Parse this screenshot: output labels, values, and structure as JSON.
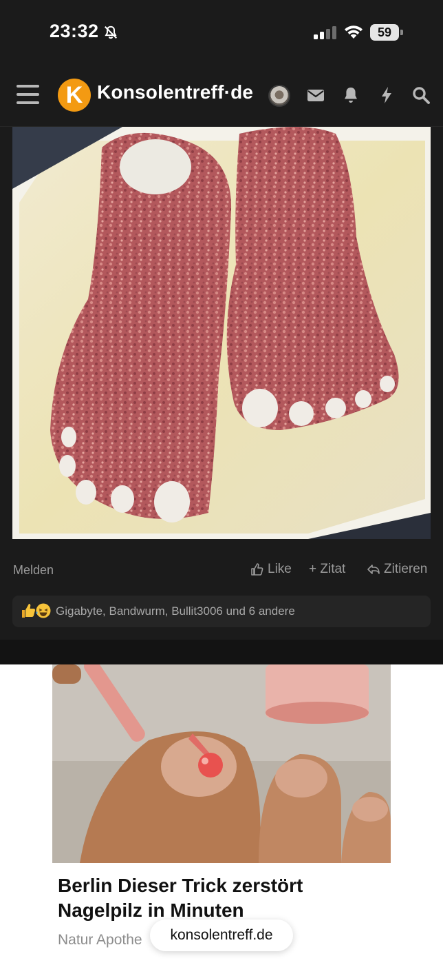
{
  "status_bar": {
    "time": "23:32",
    "battery": "59"
  },
  "header": {
    "site_name": "Konsolentreff·de",
    "logo_letter": "K"
  },
  "post": {
    "report_label": "Melden",
    "actions": {
      "like_label": "Like",
      "quote_label": "+ Zitat",
      "reply_label": "Zitieren"
    },
    "reactions_text": "Gigabyte, Bandwurm, Bullit3006 und 6 andere",
    "reaction_icons": [
      "thumbs-up-emoji",
      "laughing-emoji"
    ]
  },
  "ad": {
    "headline": "Berlin Dieser Trick zerstört Nagelpilz in Minuten",
    "source": "Natur Apothe"
  },
  "browser": {
    "url": "konsolentreff.de"
  },
  "colors": {
    "background": "#1b1b1b",
    "brand_orange": "#f39a12",
    "muted_text": "#9a9a9a"
  }
}
